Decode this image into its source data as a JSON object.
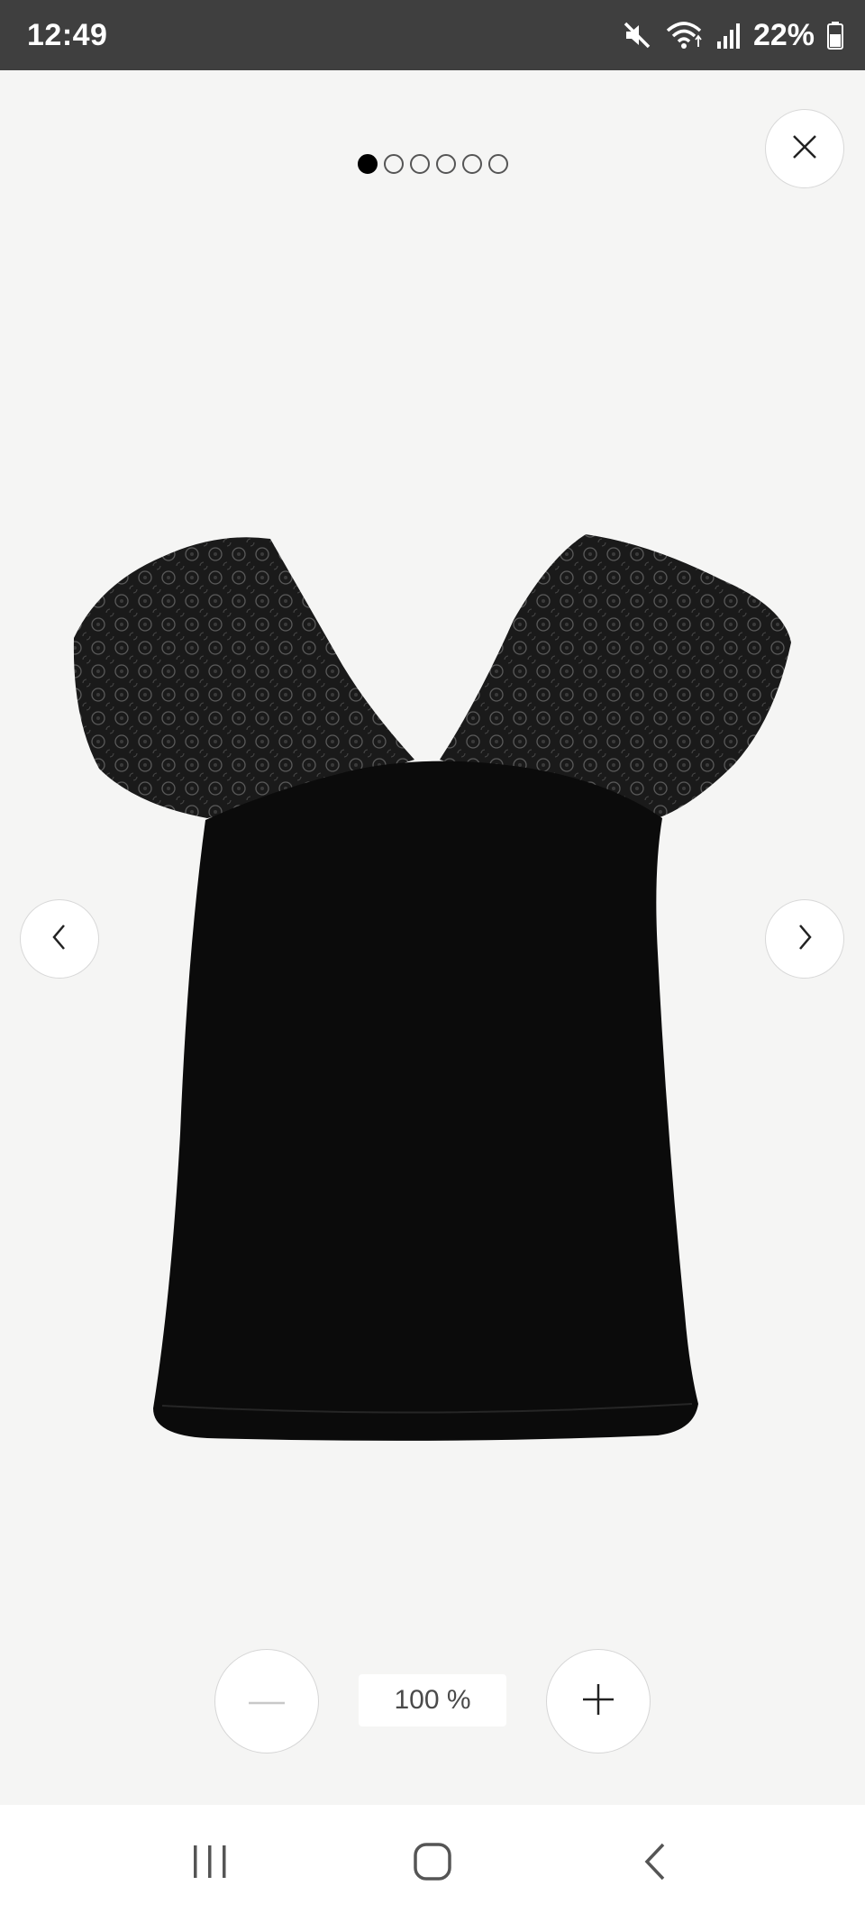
{
  "status_bar": {
    "time": "12:49",
    "battery": "22%",
    "icons": [
      "mute-icon",
      "wifi-icon",
      "signal-icon",
      "battery-icon"
    ]
  },
  "gallery": {
    "total_images": 6,
    "active_index": 0
  },
  "zoom": {
    "level": "100 %",
    "out_icon": "minus-icon",
    "in_icon": "plus-icon"
  },
  "buttons": {
    "close_icon": "close-icon",
    "prev_icon": "chevron-left-icon",
    "next_icon": "chevron-right-icon"
  },
  "nav_bar": {
    "recents_icon": "recents-icon",
    "home_icon": "home-icon",
    "back_icon": "back-icon"
  },
  "colors": {
    "background": "#f5f5f4",
    "status_bar": "#3f3f3f",
    "product": "#0b0b0b"
  }
}
